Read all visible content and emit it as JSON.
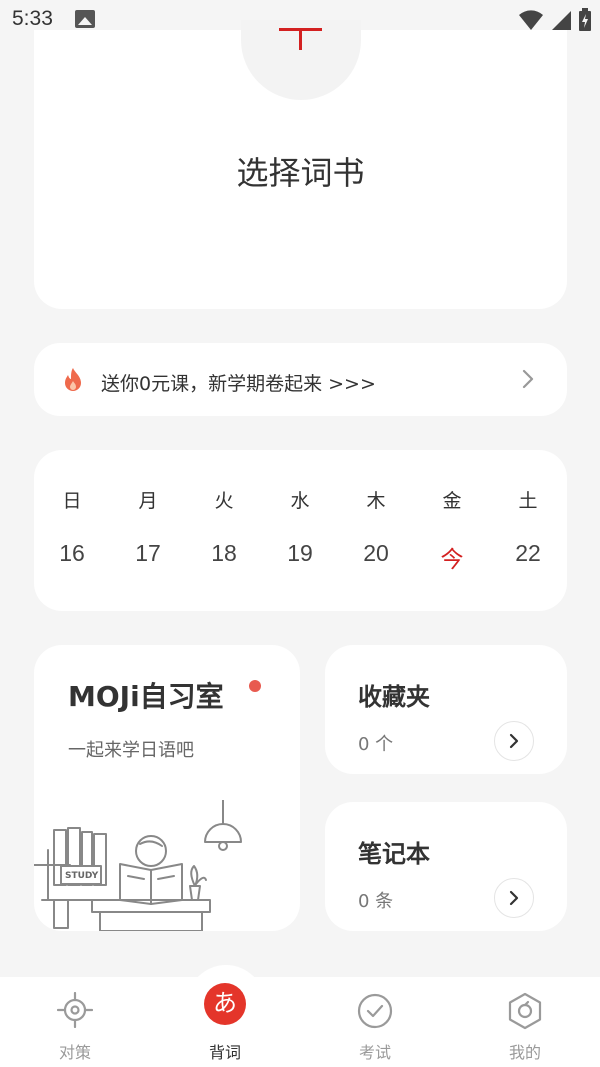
{
  "status_bar": {
    "time": "5:33"
  },
  "book": {
    "title": "选择词书"
  },
  "promo": {
    "text": "送你0元课，新学期卷起来 >>>"
  },
  "calendar": {
    "weekdays": [
      "日",
      "月",
      "火",
      "水",
      "木",
      "金",
      "土"
    ],
    "days": [
      "16",
      "17",
      "18",
      "19",
      "20",
      "今",
      "22"
    ],
    "today_index": 5,
    "today_color": "#d32020"
  },
  "study_room": {
    "title": "MOJi自习室",
    "subtitle": "一起来学日语吧",
    "sign_text": "STUDY"
  },
  "favorites": {
    "title": "收藏夹",
    "count": "0 个"
  },
  "notebook": {
    "title": "笔记本",
    "count": "0 条"
  },
  "tabs": [
    {
      "label": "对策",
      "icon": "target-icon",
      "active": false
    },
    {
      "label": "背词",
      "icon": "kana-a-icon",
      "glyph": "あ",
      "active": true
    },
    {
      "label": "考试",
      "icon": "check-circle-icon",
      "active": false
    },
    {
      "label": "我的",
      "icon": "profile-hexagon-icon",
      "active": false
    }
  ],
  "colors": {
    "accent": "#e4352a",
    "background": "#f5f5f5"
  }
}
